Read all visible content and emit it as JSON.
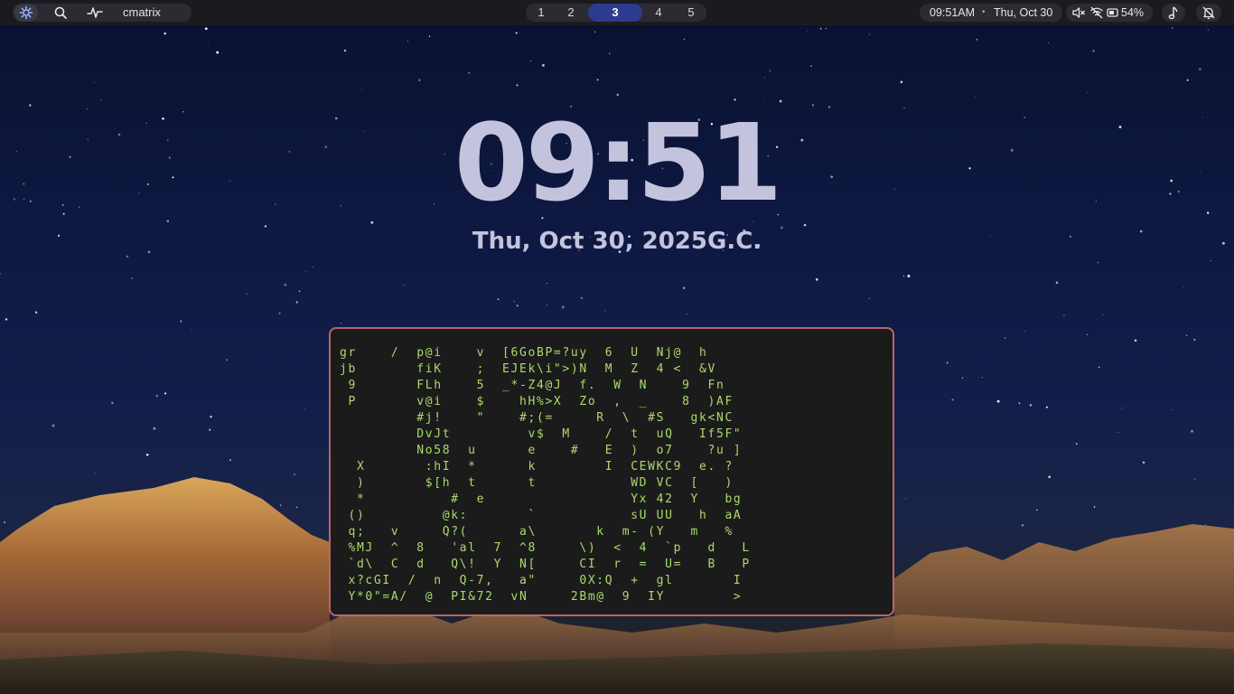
{
  "topbar": {
    "launcher_icon": "gear-flower-icon",
    "search_icon": "search-icon",
    "activity_icon": "activity-icon",
    "app_name": "cmatrix",
    "workspaces": [
      "1",
      "2",
      "3",
      "4",
      "5"
    ],
    "active_workspace": "3",
    "time": "09:51AM",
    "separator": "•",
    "date": "Thu, Oct 30",
    "volume_icon": "volume-muted-icon",
    "wifi_icon": "wifi-off-icon",
    "battery_icon": "battery-icon",
    "battery": "54%",
    "music_icon": "music-note-icon",
    "notifications_icon": "bell-off-icon"
  },
  "desktop": {
    "clock": "09:51",
    "date": "Thu, Oct 30, 2025G.C."
  },
  "terminal": {
    "title": "cmatrix",
    "lines": [
      "gr    /  p@i    v  [6GoBP=?uy  6  U  Nj@  h",
      "jb       fiK    ;  EJEk\\i\">)N  M  Z  4 <  &V",
      " 9       FLh    5  _*-Z4@J  f.  W  N    9  Fn",
      " P       v@i    $    hH%>X  Zo  ,  _    8  )AF",
      "         #j!    \"    #;(=     R  \\  #S   gk<NC",
      "         DvJt         v$  M    /  t  uQ   If5F\"",
      "         No58  u      e    #   E  )  o7    ?u ]",
      "  X       :hI  *      k        I  CEWKC9  e. ?",
      "  )       $[h  t      t           WD VC  [   )",
      "  *          #  e                 Yx 42  Y   bg",
      " ()         @k:       `           sU UU   h  aA",
      " q;   v     Q?(      a\\       k  m- (Y   m   %",
      " %MJ  ^  8   'al  7  ^8     \\)  <  4  `p   d   L",
      " `d\\  C  d   Q\\!  Y  N[     CI  r  =  U=   B   P",
      " x?cGI  /  n  Q-7,   a\"     0X:Q  +  gl       I",
      " Y*0\"=A/  @  PI&72  vN     2Bm@  9  IY        >"
    ]
  }
}
